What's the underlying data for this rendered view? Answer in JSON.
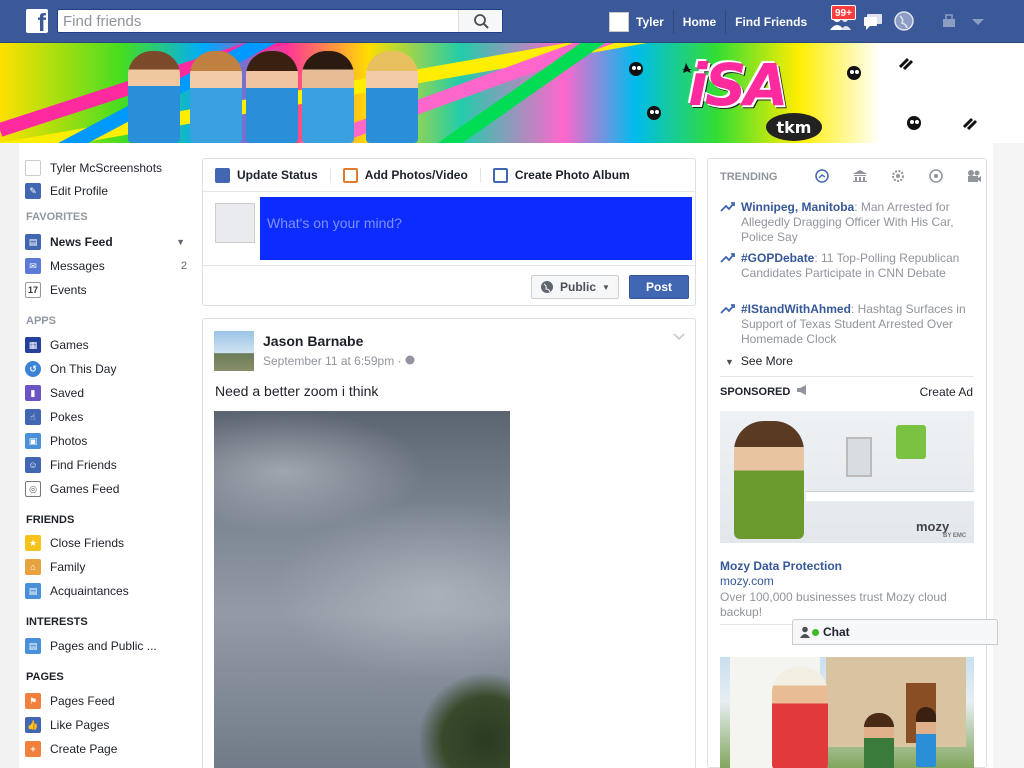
{
  "topbar": {
    "logo": "f",
    "search_placeholder": "Find friends",
    "user_name": "Tyler",
    "home": "Home",
    "find_friends": "Find Friends",
    "friend_requests_badge": "99+"
  },
  "cover": {
    "logo_text": "iSA",
    "tkm_text": "tkm"
  },
  "left": {
    "profile_name": "Tyler McScreenshots",
    "edit_profile": "Edit Profile",
    "favorites_head": "FAVORITES",
    "favorites": [
      {
        "label": "News Feed",
        "icon": "news-feed-icon"
      },
      {
        "label": "Messages",
        "icon": "messages-icon",
        "count": "2"
      },
      {
        "label": "Events",
        "icon": "events-icon",
        "icon_text": "17"
      }
    ],
    "apps_head": "APPS",
    "apps": [
      {
        "label": "Games",
        "icon": "games-icon"
      },
      {
        "label": "On This Day",
        "icon": "on-this-day-icon"
      },
      {
        "label": "Saved",
        "icon": "saved-icon"
      },
      {
        "label": "Pokes",
        "icon": "pokes-icon"
      },
      {
        "label": "Photos",
        "icon": "photos-icon"
      },
      {
        "label": "Find Friends",
        "icon": "find-friends-icon"
      },
      {
        "label": "Games Feed",
        "icon": "games-feed-icon"
      }
    ],
    "friends_head": "FRIENDS",
    "friends": [
      {
        "label": "Close Friends",
        "icon": "close-friends-icon"
      },
      {
        "label": "Family",
        "icon": "family-icon"
      },
      {
        "label": "Acquaintances",
        "icon": "acquaintances-icon"
      }
    ],
    "interests_head": "INTERESTS",
    "interests": [
      {
        "label": "Pages and Public ...",
        "icon": "pages-public-icon"
      }
    ],
    "pages_head": "PAGES",
    "pages": [
      {
        "label": "Pages Feed",
        "icon": "pages-feed-icon"
      },
      {
        "label": "Like Pages",
        "icon": "like-pages-icon"
      },
      {
        "label": "Create Page",
        "icon": "create-page-icon"
      }
    ]
  },
  "composer": {
    "tabs": [
      {
        "label": "Update Status",
        "icon": "pencil-icon"
      },
      {
        "label": "Add Photos/Video",
        "icon": "photo-icon"
      },
      {
        "label": "Create Photo Album",
        "icon": "album-icon"
      }
    ],
    "placeholder": "What's on your mind?",
    "privacy": "Public",
    "post": "Post"
  },
  "story": {
    "author": "Jason Barnabe",
    "timestamp": "September 11 at 6:59pm",
    "separator": "·",
    "body": "Need a better zoom i think"
  },
  "trending": {
    "head": "TRENDING",
    "items": [
      {
        "key": "Winnipeg, Manitoba",
        "text": ": Man Arrested for Allegedly Dragging Officer With His Car, Police Say"
      },
      {
        "key": "#GOPDebate",
        "text": ": 11 Top-Polling Republican Candidates Participate in CNN Debate"
      },
      {
        "key": "#IStandWithAhmed",
        "text": ": Hashtag Surfaces in Support of Texas Student Arrested Over Homemade Clock"
      }
    ],
    "see_more": "See More"
  },
  "sponsored": {
    "head": "SPONSORED",
    "create_ad": "Create Ad",
    "ad1": {
      "title": "Mozy Data Protection",
      "url": "mozy.com",
      "desc": "Over 100,000 businesses trust Mozy cloud backup!",
      "brand": "mozy",
      "brand_sub": "BY EMC"
    }
  },
  "chat": {
    "label": "Chat"
  },
  "colors": {
    "fb_blue": "#3b5998",
    "link": "#365899",
    "status_blue": "#0c2cff",
    "badge_red": "#fa3e3e"
  }
}
